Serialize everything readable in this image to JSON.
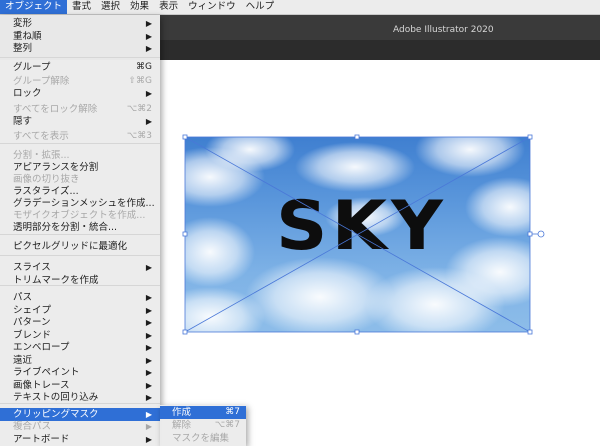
{
  "menubar": {
    "items": [
      "オブジェクト",
      "書式",
      "選択",
      "効果",
      "表示",
      "ウィンドウ",
      "ヘルプ"
    ]
  },
  "app_title": "Adobe Illustrator 2020",
  "artwork": {
    "text": "SKY"
  },
  "menu": {
    "items": [
      {
        "label": "変形",
        "shortcut": "",
        "arrow": "▶",
        "disabled": false
      },
      {
        "label": "重ね順",
        "shortcut": "",
        "arrow": "▶",
        "disabled": false
      },
      {
        "label": "整列",
        "shortcut": "",
        "arrow": "▶",
        "disabled": false
      },
      {
        "label": "グループ",
        "shortcut": "⌘G",
        "arrow": "",
        "disabled": false
      },
      {
        "label": "グループ解除",
        "shortcut": "⇧⌘G",
        "arrow": "",
        "disabled": true
      },
      {
        "label": "ロック",
        "shortcut": "",
        "arrow": "▶",
        "disabled": false
      },
      {
        "label": "すべてをロック解除",
        "shortcut": "⌥⌘2",
        "arrow": "",
        "disabled": true
      },
      {
        "label": "隠す",
        "shortcut": "",
        "arrow": "▶",
        "disabled": false
      },
      {
        "label": "すべてを表示",
        "shortcut": "⌥⌘3",
        "arrow": "",
        "disabled": true
      },
      {
        "label": "分割・拡張...",
        "shortcut": "",
        "arrow": "",
        "disabled": true
      },
      {
        "label": "アピアランスを分割",
        "shortcut": "",
        "arrow": "",
        "disabled": false
      },
      {
        "label": "画像の切り抜き",
        "shortcut": "",
        "arrow": "",
        "disabled": true
      },
      {
        "label": "ラスタライズ...",
        "shortcut": "",
        "arrow": "",
        "disabled": false
      },
      {
        "label": "グラデーションメッシュを作成...",
        "shortcut": "",
        "arrow": "",
        "disabled": false
      },
      {
        "label": "モザイクオブジェクトを作成...",
        "shortcut": "",
        "arrow": "",
        "disabled": true
      },
      {
        "label": "透明部分を分割・統合...",
        "shortcut": "",
        "arrow": "",
        "disabled": false
      },
      {
        "label": "ピクセルグリッドに最適化",
        "shortcut": "",
        "arrow": "",
        "disabled": false
      },
      {
        "label": "スライス",
        "shortcut": "",
        "arrow": "▶",
        "disabled": false
      },
      {
        "label": "トリムマークを作成",
        "shortcut": "",
        "arrow": "",
        "disabled": false
      },
      {
        "label": "パス",
        "shortcut": "",
        "arrow": "▶",
        "disabled": false
      },
      {
        "label": "シェイプ",
        "shortcut": "",
        "arrow": "▶",
        "disabled": false
      },
      {
        "label": "パターン",
        "shortcut": "",
        "arrow": "▶",
        "disabled": false
      },
      {
        "label": "ブレンド",
        "shortcut": "",
        "arrow": "▶",
        "disabled": false
      },
      {
        "label": "エンベロープ",
        "shortcut": "",
        "arrow": "▶",
        "disabled": false
      },
      {
        "label": "遠近",
        "shortcut": "",
        "arrow": "▶",
        "disabled": false
      },
      {
        "label": "ライブペイント",
        "shortcut": "",
        "arrow": "▶",
        "disabled": false
      },
      {
        "label": "画像トレース",
        "shortcut": "",
        "arrow": "▶",
        "disabled": false
      },
      {
        "label": "テキストの回り込み",
        "shortcut": "",
        "arrow": "▶",
        "disabled": false
      },
      {
        "label": "クリッピングマスク",
        "shortcut": "",
        "arrow": "▶",
        "disabled": false,
        "highlighted": true
      },
      {
        "label": "複合パス",
        "shortcut": "",
        "arrow": "▶",
        "disabled": true
      },
      {
        "label": "アートボード",
        "shortcut": "",
        "arrow": "▶",
        "disabled": false
      }
    ]
  },
  "submenu": {
    "items": [
      {
        "label": "作成",
        "shortcut": "⌘7",
        "disabled": false,
        "highlighted": true
      },
      {
        "label": "解除",
        "shortcut": "⌥⌘7",
        "disabled": true
      },
      {
        "label": "マスクを編集",
        "shortcut": "",
        "disabled": true
      }
    ]
  },
  "colors": {
    "accent": "#2f6fd6",
    "selection": "#4a78d8"
  }
}
